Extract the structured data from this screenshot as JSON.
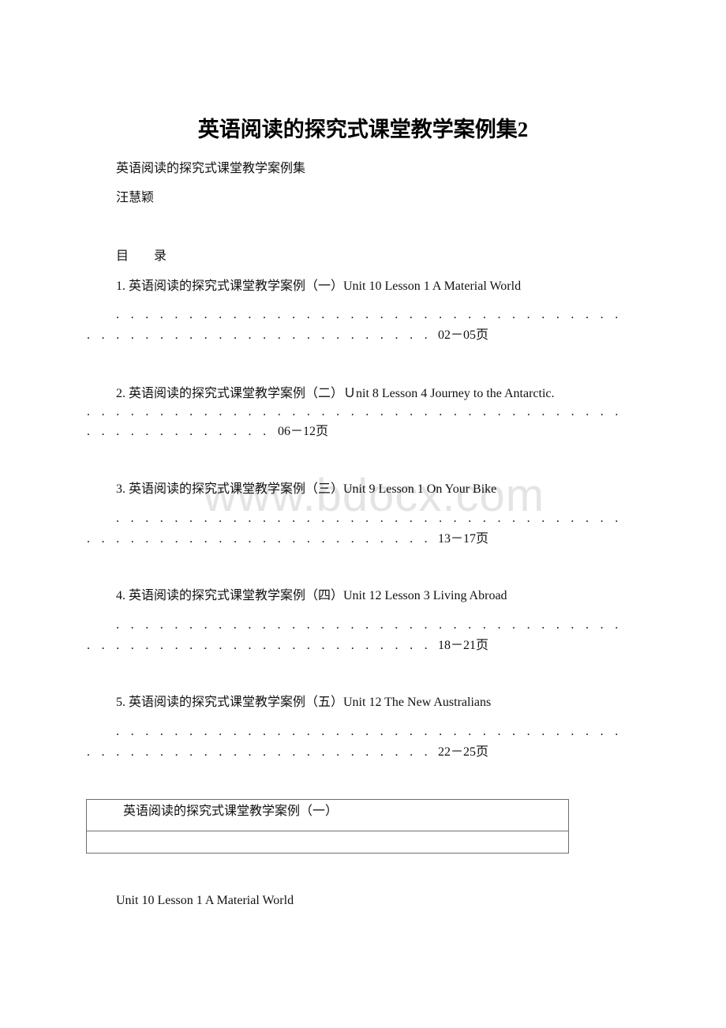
{
  "document": {
    "title": "英语阅读的探究式课堂教学案例集2",
    "subtitle": "英语阅读的探究式课堂教学案例集",
    "author": "汪慧颖",
    "toc_heading": "目　　录",
    "watermark": "www.bdocx.com"
  },
  "toc": [
    {
      "label": "1. 英语阅读的探究式课堂教学案例（一）Unit 10 Lesson 1 A Material World",
      "pages": "02－05页"
    },
    {
      "label": "2. 英语阅读的探究式课堂教学案例（二）Ｕnit 8 Lesson 4 Journey to the Antarctic.",
      "pages": "06－12页"
    },
    {
      "label": "3. 英语阅读的探究式课堂教学案例（三）Unit 9 Lesson 1 On Your Bike",
      "pages": "13－17页"
    },
    {
      "label": "4. 英语阅读的探究式课堂教学案例（四）Unit 12 Lesson 3 Living Abroad",
      "pages": "18－21页"
    },
    {
      "label": "5. 英语阅读的探究式课堂教学案例（五）Unit 12 The New Australians",
      "pages": "22－25页"
    }
  ],
  "section_box": {
    "header": "英语阅读的探究式课堂教学案例（一）",
    "second_row": ""
  },
  "section_heading": "Unit 10 Lesson 1 A Material World"
}
